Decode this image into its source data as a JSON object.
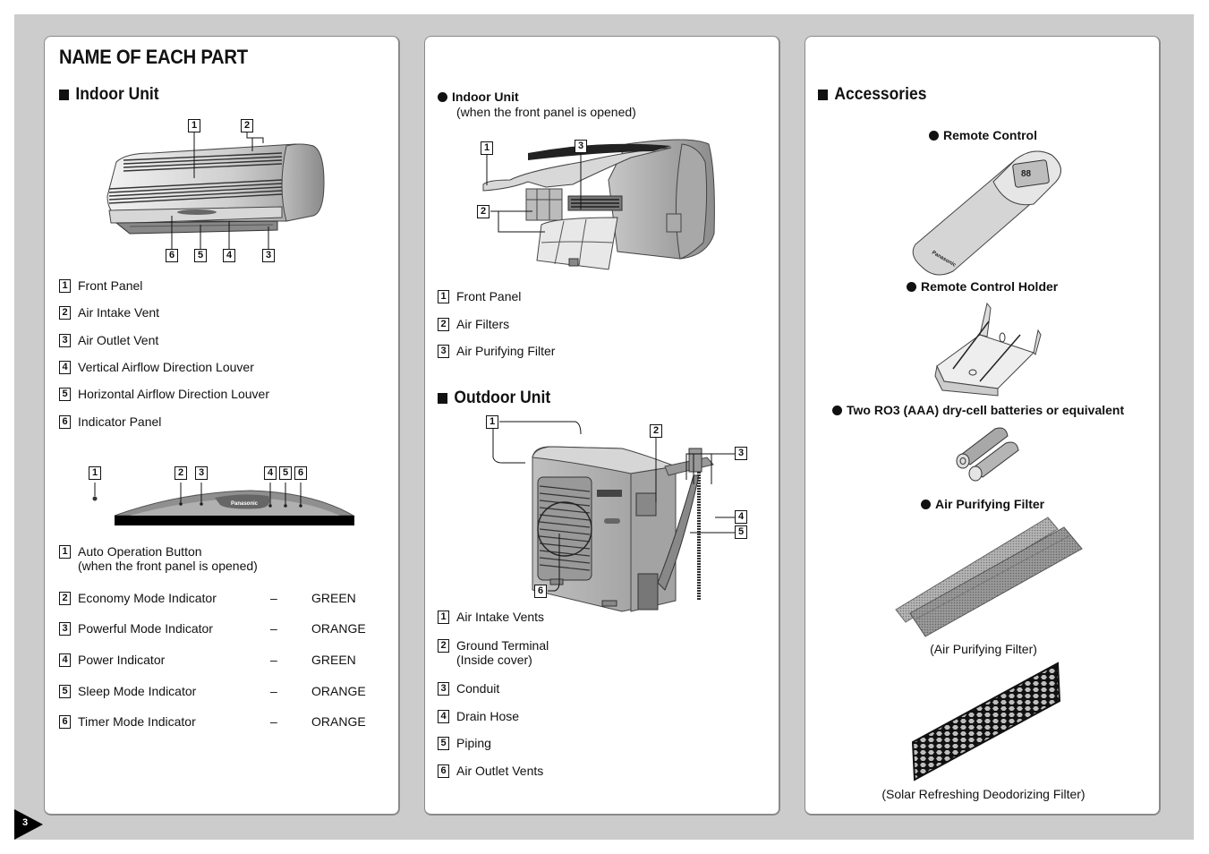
{
  "page": {
    "title": "NAME OF EACH PART",
    "page_number": "3"
  },
  "indoor_unit": {
    "heading": "Indoor Unit",
    "diagram_callouts": [
      "1",
      "2",
      "6",
      "5",
      "4",
      "3"
    ],
    "parts": [
      {
        "num": "1",
        "label": "Front Panel"
      },
      {
        "num": "2",
        "label": "Air Intake Vent"
      },
      {
        "num": "3",
        "label": "Air Outlet Vent"
      },
      {
        "num": "4",
        "label": "Vertical Airflow Direction Louver"
      },
      {
        "num": "5",
        "label": "Horizontal Airflow Direction Louver"
      },
      {
        "num": "6",
        "label": "Indicator Panel"
      }
    ],
    "indicator_panel": {
      "callouts": [
        "1",
        "2",
        "3",
        "4",
        "5",
        "6"
      ],
      "brand": "Panasonic",
      "items": [
        {
          "num": "1",
          "label": "Auto Operation Button",
          "sub": "(when the front panel is opened)",
          "dash": "",
          "color": ""
        },
        {
          "num": "2",
          "label": "Economy Mode Indicator",
          "sub": "",
          "dash": "–",
          "color": "GREEN"
        },
        {
          "num": "3",
          "label": "Powerful Mode Indicator",
          "sub": "",
          "dash": "–",
          "color": "ORANGE"
        },
        {
          "num": "4",
          "label": "Power Indicator",
          "sub": "",
          "dash": "–",
          "color": "GREEN"
        },
        {
          "num": "5",
          "label": "Sleep Mode Indicator",
          "sub": "",
          "dash": "–",
          "color": "ORANGE"
        },
        {
          "num": "6",
          "label": "Timer Mode Indicator",
          "sub": "",
          "dash": "–",
          "color": "ORANGE"
        }
      ]
    }
  },
  "indoor_opened": {
    "heading": "Indoor Unit",
    "subheading": "(when the front panel is opened)",
    "diagram_callouts": [
      "1",
      "3",
      "2"
    ],
    "parts": [
      {
        "num": "1",
        "label": "Front Panel"
      },
      {
        "num": "2",
        "label": "Air Filters"
      },
      {
        "num": "3",
        "label": "Air Purifying Filter"
      }
    ]
  },
  "outdoor_unit": {
    "heading": "Outdoor Unit",
    "diagram_callouts": [
      "1",
      "2",
      "3",
      "4",
      "5",
      "6"
    ],
    "parts": [
      {
        "num": "1",
        "label": "Air Intake Vents",
        "sub": ""
      },
      {
        "num": "2",
        "label": "Ground Terminal",
        "sub": "(Inside cover)"
      },
      {
        "num": "3",
        "label": "Conduit",
        "sub": ""
      },
      {
        "num": "4",
        "label": "Drain Hose",
        "sub": ""
      },
      {
        "num": "5",
        "label": "Piping",
        "sub": ""
      },
      {
        "num": "6",
        "label": "Air Outlet Vents",
        "sub": ""
      }
    ]
  },
  "accessories": {
    "heading": "Accessories",
    "items": [
      {
        "label": "Remote Control"
      },
      {
        "label": "Remote Control Holder"
      },
      {
        "label": "Two RO3 (AAA) dry-cell batteries or equivalent"
      },
      {
        "label": "Air Purifying Filter"
      }
    ],
    "captions": [
      "(Air Purifying Filter)",
      "(Solar Refreshing Deodorizing Filter)"
    ],
    "remote_brand": "Panasonic"
  }
}
